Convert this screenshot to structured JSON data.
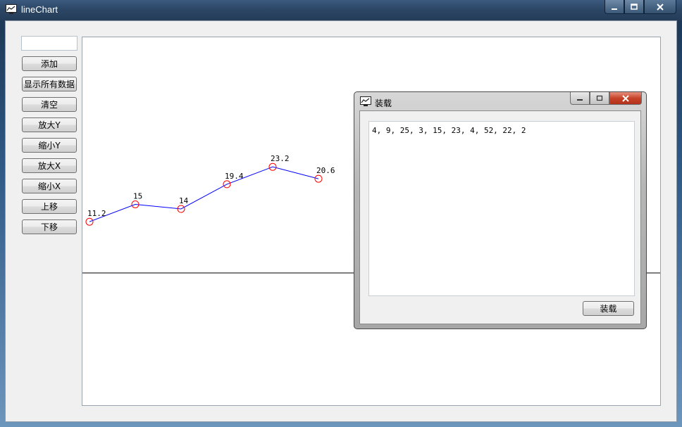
{
  "window": {
    "title": "lineChart"
  },
  "controls": {
    "input_value": "",
    "buttons": [
      "添加",
      "显示所有数据",
      "清空",
      "放大Y",
      "缩小Y",
      "放大X",
      "缩小X",
      "上移",
      "下移"
    ]
  },
  "chart_data": {
    "type": "line",
    "x": [
      1,
      2,
      3,
      4,
      5,
      6
    ],
    "values": [
      11.2,
      15,
      14,
      19.4,
      23.2,
      20.6
    ],
    "point_labels": [
      "11.2",
      "15",
      "14",
      "19.4",
      "23.2",
      "20.6"
    ],
    "line_color": "#0000ff",
    "marker_color": "#ff0000",
    "baseline": 0
  },
  "dialog": {
    "title": "装载",
    "text": "4, 9, 25, 3, 15, 23, 4, 52, 22, 2",
    "load_button": "装载"
  }
}
